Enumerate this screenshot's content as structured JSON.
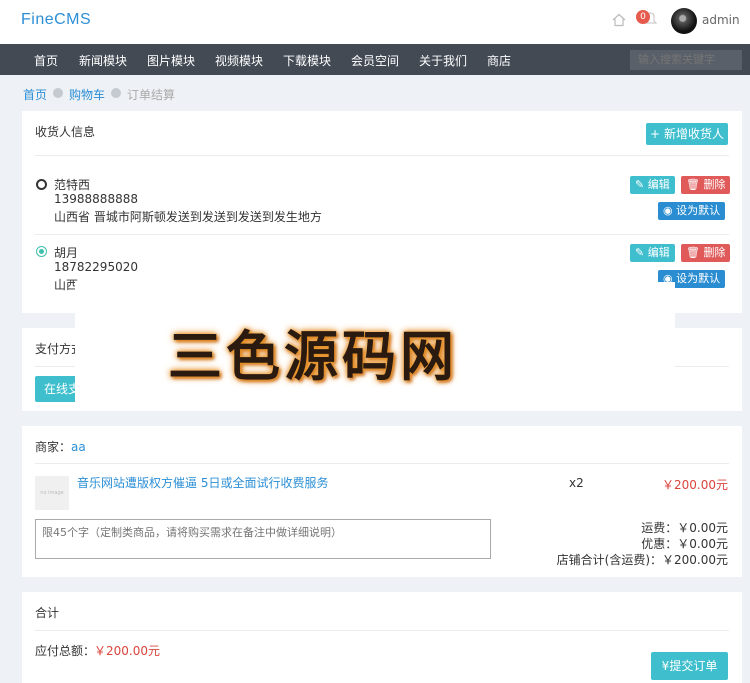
{
  "header": {
    "logo": "FineCMS",
    "notification_count": "0",
    "username": "admin"
  },
  "nav": {
    "items": [
      "首页",
      "新闻模块",
      "图片模块",
      "视频模块",
      "下载模块",
      "会员空间",
      "关于我们",
      "商店"
    ],
    "search_placeholder": "输入搜索关键字"
  },
  "breadcrumb": {
    "home": "首页",
    "cart": "购物车",
    "current": "订单结算"
  },
  "receiver": {
    "title": "收货人信息",
    "add_button": "新增收货人",
    "edit_label": "编辑",
    "delete_label": "删除",
    "set_default_label": "设为默认",
    "addresses": [
      {
        "name": "范特西",
        "phone": "13988888888",
        "address": "山西省 晋城市阿斯顿发送到发送到发送到发生地方",
        "selected": false
      },
      {
        "name": "胡月",
        "phone": "18782295020",
        "address": "山西",
        "selected": true
      }
    ]
  },
  "payment": {
    "title": "支付方式",
    "online_button": "在线支付"
  },
  "watermark": "三色源码网",
  "merchant": {
    "label": "商家：",
    "name": "aa",
    "product_name": "音乐网站遭版权方催逼 5日或全面试行收费服务",
    "thumb_text": "no image",
    "quantity": "x2",
    "price": "￥200.00元",
    "remark_placeholder": "限45个字（定制类商品，请将购买需求在备注中做详细说明）",
    "shipping": "运费：￥0.00元",
    "discount": "优惠：￥0.00元",
    "shop_total": "店铺合计(含运费)：￥200.00元"
  },
  "total": {
    "title": "合计",
    "label": "应付总额：",
    "amount": "￥200.00元",
    "submit_button": "提交订单"
  },
  "colors": {
    "accent": "#2c8fd6",
    "teal": "#3fbfce",
    "danger": "#e05a5a",
    "price": "#d9443c",
    "nav_bg": "#434a54"
  }
}
